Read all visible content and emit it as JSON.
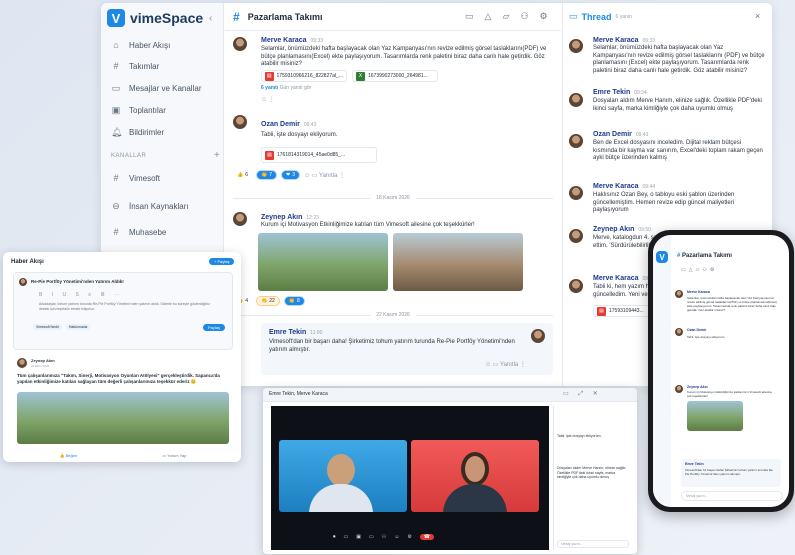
{
  "app": {
    "name": "vimeSpace",
    "logo_letter": "V",
    "brand_color": "#1e88e5"
  },
  "sidebar": {
    "items": [
      {
        "label": "Haber Akışı",
        "icon": "home-icon"
      },
      {
        "label": "Takımlar",
        "icon": "hash-icon"
      },
      {
        "label": "Mesajlar ve Kanallar",
        "icon": "chat-icon"
      },
      {
        "label": "Toplantılar",
        "icon": "video-icon"
      },
      {
        "label": "Bildirimler",
        "icon": "bell-icon"
      }
    ],
    "section": "KANALLAR",
    "channels": [
      "Vimesoft",
      "İnsan Kaynakları",
      "Muhasebe"
    ]
  },
  "chat": {
    "title": "Pazarlama Takımı",
    "messages": [
      {
        "name": "Merve Karaca",
        "time": "09:33",
        "text": "Selamlar, önümüzdeki hafta başlayacak olan Yaz Kampanyası'nın revize edilmiş görsel taslaklarını(PDF) ve bütçe planlamasını(Excel) ekte paylaşıyorum. Tasarımlarda renk paletini biraz daha canlı hale getirdik. Göz atabilir misiniz?",
        "files": [
          "1759310966216_822827al_...",
          "1673990273000_264981..."
        ],
        "replies": "6 yanıtı",
        "reply_time": "Gün yanıtı gör"
      },
      {
        "name": "Ozan Demir",
        "time": "09:43",
        "text": "Tabii, işte dosyayı ekliyorum.",
        "files": [
          "1761814319014_45ae0d85_..."
        ],
        "reactions": [
          "6",
          "7",
          "3"
        ],
        "reply_label": "Yanıtla"
      },
      {
        "name": "Zeynep Akın",
        "time": "12:23",
        "text": "Kurum içi Motivasyon Etkinliğimize katılan tüm Vimesoft ailesine çok teşekkürler!",
        "reactions": [
          "4",
          "22",
          "8"
        ]
      },
      {
        "name": "Emre Tekin",
        "time": "11:00",
        "text": "Vimesoft'dan bir başarı daha! Şirketimiz tohum yatırım turunda Re-Pie Portföy Yönetimi'nden yatırım almıştır.",
        "reply_label": "Yanıtla"
      }
    ],
    "dates": [
      "18 Kasım 2026",
      "22 Kasım 2026"
    ]
  },
  "thread": {
    "title": "Thread",
    "count": "6 yanıtı",
    "messages": [
      {
        "name": "Merve Karaca",
        "time": "09:33",
        "text": "Selamlar, önümüzdeki hafta başlayacak olan Yaz Kampanyası'nın revize edilmiş görsel taslaklarını (PDF) ve bütçe planlamasını (Excel) ekte paylaşıyorum. Tasarımlarda renk paletini biraz daha canlı hale getirdik. Göz atabilir misiniz?"
      },
      {
        "name": "Emre Tekin",
        "time": "09:34",
        "text": "Dosyaları aldım Merve Hanım, elinize sağlık. Özellikle PDF'deki ikinci sayfa, marka kimliğiyle çok daha uyumlu olmuş"
      },
      {
        "name": "Ozan Demir",
        "time": "09:43",
        "text": "Ben de Excel dosyasını inceledim. Dijital reklam bütçesi kısmında bir kayma var sanırım, Excel'deki toplam rakam geçen ayki bütçe üzerinden kalmış"
      },
      {
        "name": "Merve Karaca",
        "time": "09:44",
        "text": "Haklısınız Ozan Bey, o tabloyu eski şablon üzerinden güncellemiştim. Hemen revize edip güncel maliyetleri paylaşıyorum"
      },
      {
        "name": "Zeynep Akın",
        "time": "09:50",
        "text": "Merve, katalogdun 4. sayfasında küçük bir yazım hatası fark ettim. 'Sürdürülebilirlik' kelimesi... Onu da düzeltebilir misin?"
      },
      {
        "name": "Merve Karaca",
        "time": "09:51",
        "text": "Tabii ki, hem yazım hatasını düzelttim hem de tabloyu güncelledim. Yeni versiyonu ekliyorum",
        "file": "17593109443..."
      }
    ]
  },
  "feed_card": {
    "title": "Haber Akışı",
    "share": "+ Paylaş",
    "compose": "Re-Pie Portföy Yönetimi'nden Yatırım Aldık!",
    "body": "Arkadaşlar, tohum yatırım turunda Re-Pie Portföy Yönetimi'nden yatırım aldık. Sizlerle bu süreçte gösterdiğiniz destek için teşekkür etmek istiyoruz.",
    "tags": [
      "Vimesoft Nedir",
      "Hakkımızda"
    ],
    "send": "Paylaş",
    "post_author": "Zeynep Akın",
    "post_date": "29 Ekim 2025",
    "post_text": "Tüm çalışanlarımıza \"Takım, Sinerji, Motivasyon Oyunları Atölyesi\" gerçekleştirdik. Sapanca'da yapılan etkinliğimize katılan sağlayan tüm değerli çalışanlarımıza teşekkür ederiz 😊",
    "likes": "Beğen",
    "comments": "Yorum Yap"
  },
  "video": {
    "title": "Emre Tekin, Merve Karaca",
    "panel_label": "Mesaj yazın...",
    "controls": [
      "Kayıt",
      "Kamera",
      "Ekran",
      "Sohbet",
      "Katılımcılar",
      "Reaksiyon",
      "Ayarlar",
      "Ayrıl"
    ]
  },
  "phone": {
    "title": "Pazarlama Takımı",
    "input": "Mesaj yazın..."
  }
}
